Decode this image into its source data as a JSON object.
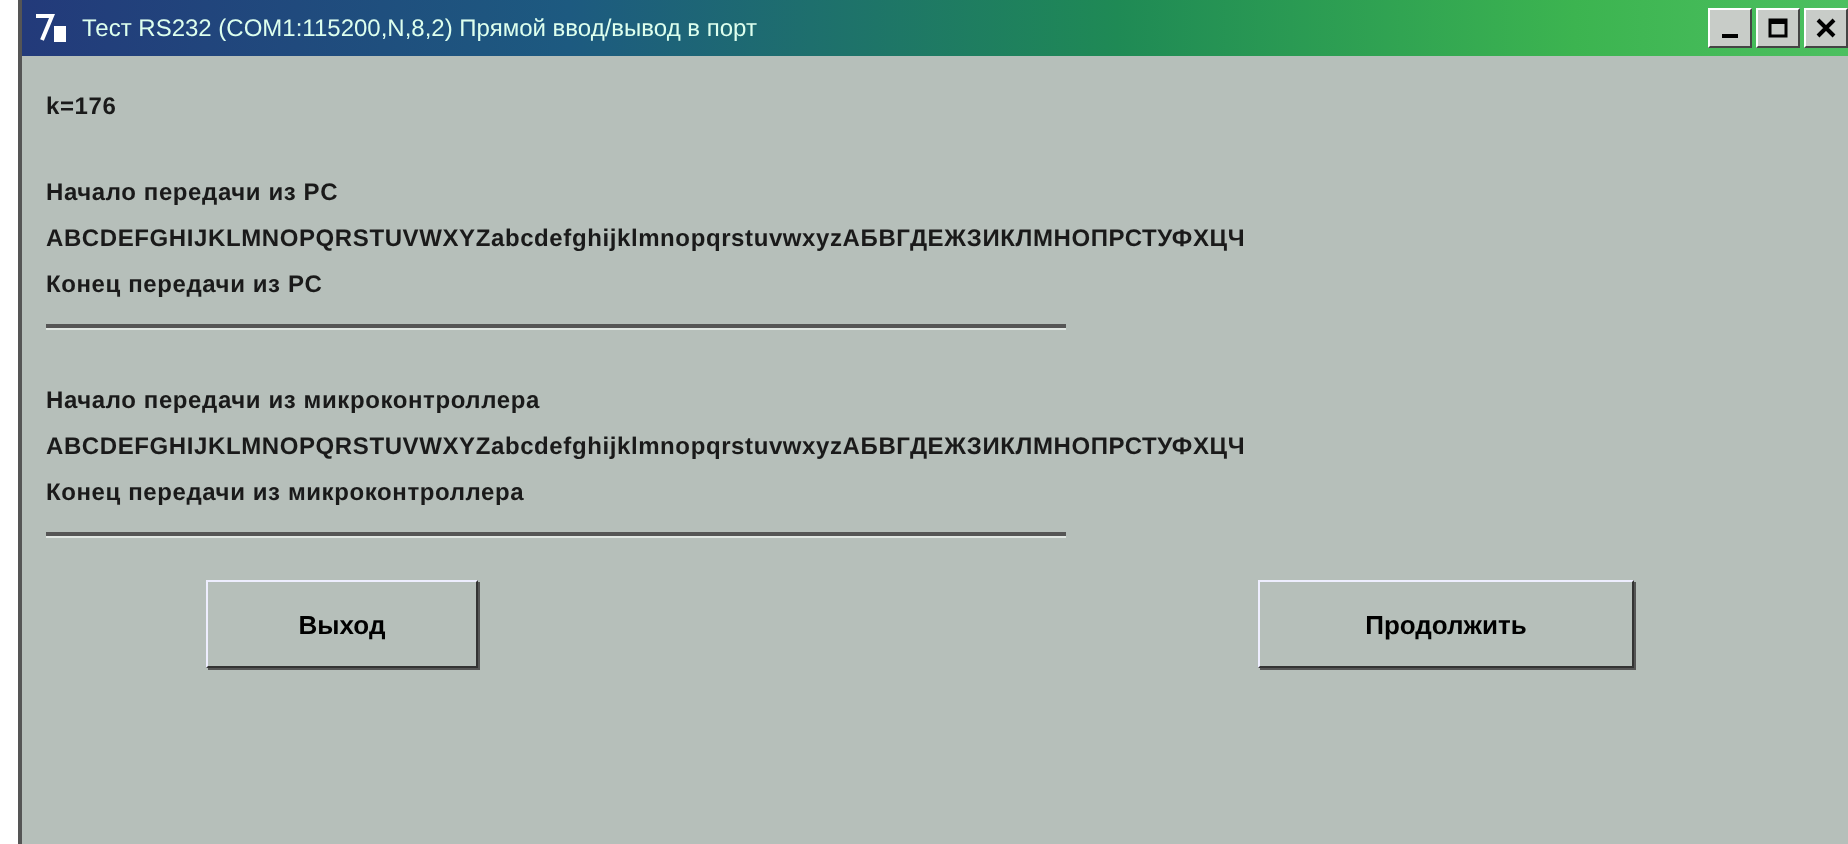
{
  "window": {
    "title": "Тест RS232 (COM1:115200,N,8,2)  Прямой ввод/вывод в порт"
  },
  "counter": "k=176",
  "sections": [
    {
      "start": "Начало передачи из PC",
      "data": "ABCDEFGHIJKLMNOPQRSTUVWXYZabcdefghijklmnopqrstuvwxyzАБВГДЕЖЗИКЛМНОПРСТУФХЦЧ",
      "end": "Конец передачи из PC"
    },
    {
      "start": "Начало передачи из микроконтроллера",
      "data": "ABCDEFGHIJKLMNOPQRSTUVWXYZabcdefghijklmnopqrstuvwxyzАБВГДЕЖЗИКЛМНОПРСТУФХЦЧ",
      "end": "Конец передачи из микроконтроллера"
    }
  ],
  "buttons": [
    "Выход",
    "Продолжить"
  ]
}
